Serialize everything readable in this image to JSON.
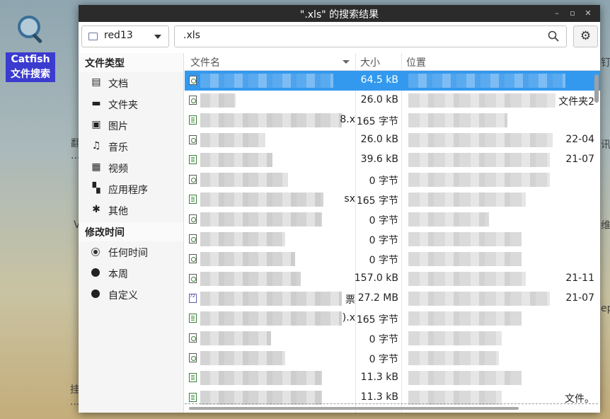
{
  "desktop": {
    "catfish_label": "Catfish 文件搜索",
    "bg_left": [
      "翻",
      "...",
      "V",
      "挂",
      "..."
    ],
    "bg_right": [
      "钉",
      "讯",
      "维",
      "ep"
    ]
  },
  "window": {
    "title": "\".xls\" 的搜索结果",
    "controls": {
      "minimize": "–",
      "restore": "▫",
      "close": "✕"
    }
  },
  "toolbar": {
    "location": "red13",
    "query": ".xls"
  },
  "sidebar": {
    "filetype_header": "文件类型",
    "filetypes": [
      {
        "label": "文档",
        "icon": "document-icon",
        "glyph": "▤"
      },
      {
        "label": "文件夹",
        "icon": "folder-icon",
        "glyph": "▬"
      },
      {
        "label": "图片",
        "icon": "image-icon",
        "glyph": "▣"
      },
      {
        "label": "音乐",
        "icon": "music-icon",
        "glyph": "♫"
      },
      {
        "label": "视频",
        "icon": "video-icon",
        "glyph": "▦"
      },
      {
        "label": "应用程序",
        "icon": "application-icon",
        "glyph": "▚"
      },
      {
        "label": "其他",
        "icon": "other-icon",
        "glyph": "✱"
      }
    ],
    "modified_header": "修改时间",
    "modified": [
      {
        "label": "任何时间",
        "selected": true
      },
      {
        "label": "本周",
        "selected": false
      },
      {
        "label": "自定义",
        "selected": false
      }
    ]
  },
  "table": {
    "columns": {
      "name": "文件名",
      "size": "大小",
      "location": "位置"
    },
    "rows": [
      {
        "icon": "doc",
        "size": "64.5 kB",
        "name_tail": "",
        "loc_tail": "",
        "selected": true
      },
      {
        "icon": "doc",
        "size": "26.0 kB",
        "name_tail": "",
        "loc_tail": "文件夹2"
      },
      {
        "icon": "sheet",
        "size": "165 字节",
        "name_tail": "8.x",
        "loc_tail": ""
      },
      {
        "icon": "doc",
        "size": "26.0 kB",
        "name_tail": "",
        "loc_tail": "22-04"
      },
      {
        "icon": "sheet",
        "size": "39.6 kB",
        "name_tail": "",
        "loc_tail": "21-07"
      },
      {
        "icon": "doc",
        "size": "0 字节",
        "name_tail": "",
        "loc_tail": ""
      },
      {
        "icon": "sheet",
        "size": "165 字节",
        "name_tail": "sx",
        "loc_tail": ""
      },
      {
        "icon": "doc",
        "size": "0 字节",
        "name_tail": "",
        "loc_tail": ""
      },
      {
        "icon": "doc",
        "size": "0 字节",
        "name_tail": "",
        "loc_tail": ""
      },
      {
        "icon": "doc",
        "size": "0 字节",
        "name_tail": "",
        "loc_tail": ""
      },
      {
        "icon": "doc",
        "size": "157.0 kB",
        "name_tail": "",
        "loc_tail": "21-11"
      },
      {
        "icon": "zip",
        "size": "27.2 MB",
        "name_tail": "票",
        "loc_tail": "21-07"
      },
      {
        "icon": "sheet",
        "size": "165 字节",
        "name_tail": ").x",
        "loc_tail": ""
      },
      {
        "icon": "doc",
        "size": "0 字节",
        "name_tail": "",
        "loc_tail": ""
      },
      {
        "icon": "doc",
        "size": "0 字节",
        "name_tail": "",
        "loc_tail": ""
      },
      {
        "icon": "sheet",
        "size": "11.3 kB",
        "name_tail": "",
        "loc_tail": ""
      },
      {
        "icon": "sheet",
        "size": "11.3 kB",
        "name_tail": "",
        "loc_tail": "文件。"
      }
    ]
  },
  "colors": {
    "selection": "#3399ee",
    "titlebar": "#2b2b2b",
    "desktop_label": "#3b3bd0"
  }
}
